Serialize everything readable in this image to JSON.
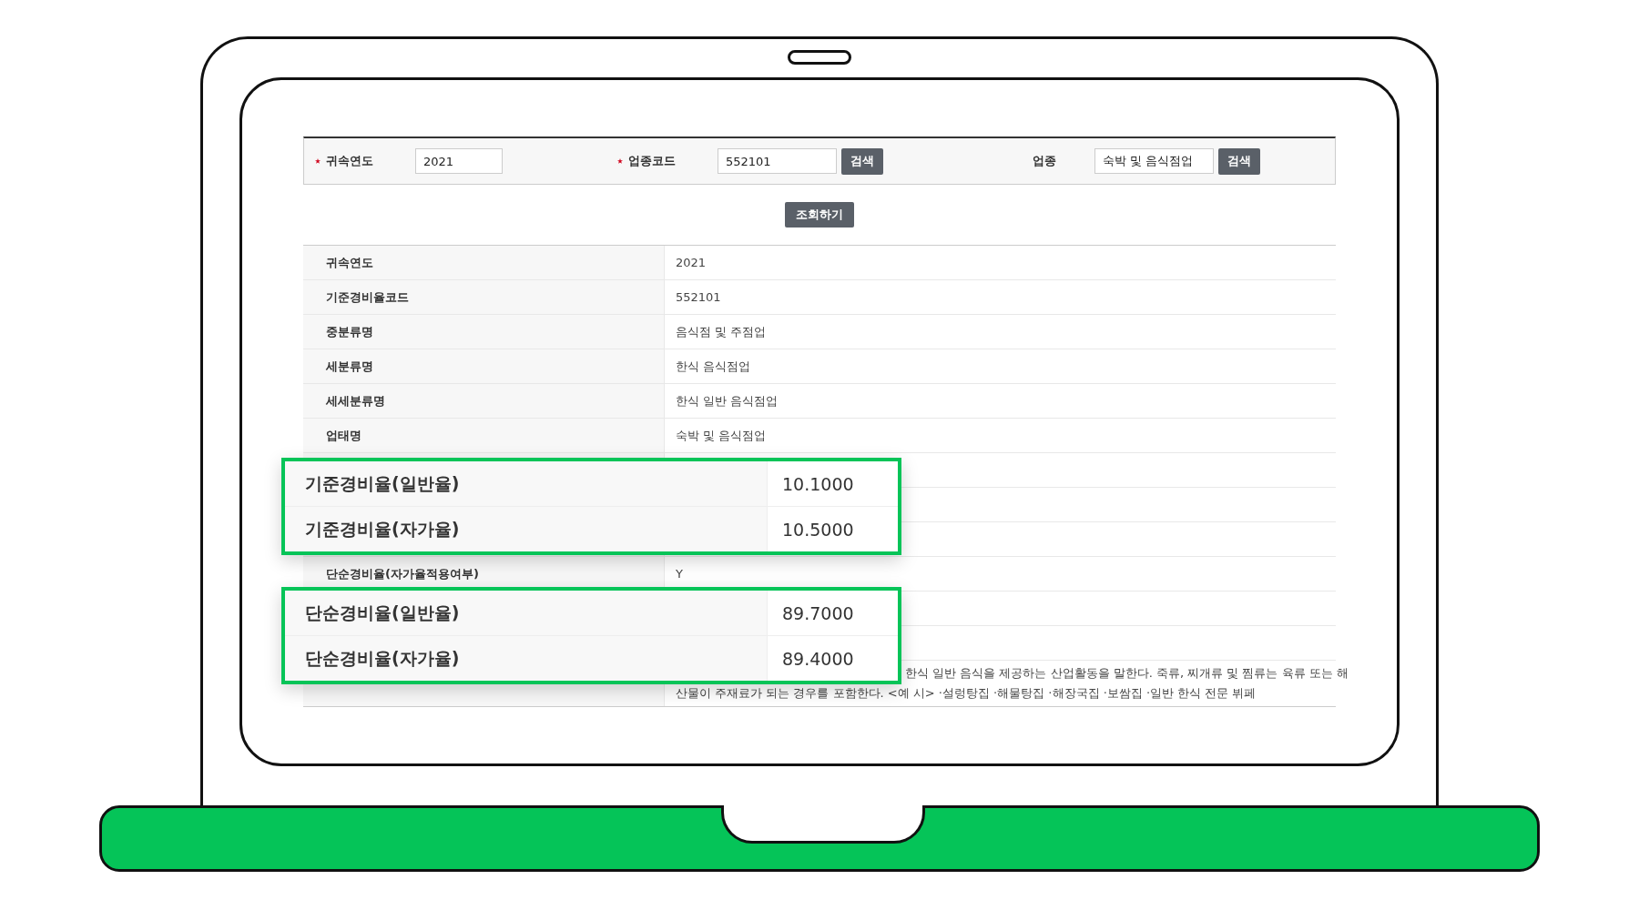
{
  "search_form": {
    "fields": [
      {
        "label": "귀속연도",
        "required": true,
        "value": "2021"
      },
      {
        "label": "업종코드",
        "required": true,
        "value": "552101",
        "button": "검색"
      },
      {
        "label": "업종",
        "required": false,
        "value": "숙박 및 음식점업",
        "button": "검색"
      }
    ]
  },
  "submit_button": "조회하기",
  "table": {
    "rows": [
      {
        "kind": "text",
        "label": "귀속연도",
        "value": "2021"
      },
      {
        "kind": "text",
        "label": "기준경비율코드",
        "value": "552101"
      },
      {
        "kind": "text",
        "label": "중분류명",
        "value": "음식점 및 주점업"
      },
      {
        "kind": "text",
        "label": "세분류명",
        "value": "한식 음식점업"
      },
      {
        "kind": "text",
        "label": "세세분류명",
        "value": "한식 일반 음식점업"
      },
      {
        "kind": "text",
        "label": "업태명",
        "value": "숙박 및 음식점업"
      },
      {
        "kind": "covered"
      },
      {
        "kind": "hidden"
      },
      {
        "kind": "covered"
      },
      {
        "kind": "text",
        "label": "단순경비율(자가율적용여부)",
        "value": "Y"
      },
      {
        "kind": "hidden"
      },
      {
        "kind": "hidden"
      },
      {
        "kind": "note",
        "lines": [
          "한식 일반 음식을 제공하는 산업활동을 말한다. 죽류, 찌개류 및 찜류는 육류 또는 해",
          "산물이 주재료가 되는 경우를 포함한다. <예 시> ·설렁탕집 ·해물탕집 ·해장국집 ·보쌈집 ·일반 한식 전문 뷔페"
        ]
      }
    ]
  },
  "callouts": [
    {
      "rows": [
        {
          "label": "기준경비율(일반율)",
          "value": "10.1000"
        },
        {
          "label": "기준경비율(자가율)",
          "value": "10.5000"
        }
      ]
    },
    {
      "rows": [
        {
          "label": "단순경비율(일반율)",
          "value": "89.7000"
        },
        {
          "label": "단순경비율(자가율)",
          "value": "89.4000"
        }
      ]
    }
  ]
}
